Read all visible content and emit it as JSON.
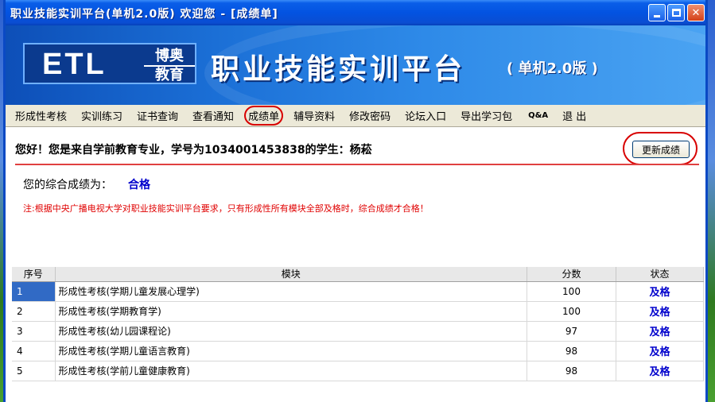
{
  "window": {
    "title": "职业技能实训平台(单机2.0版)  欢迎您 - [成绩单]"
  },
  "banner": {
    "logo_text": "ETL",
    "logo_cn_line1": "博奥",
    "logo_cn_line2": "教育",
    "title": "职业技能实训平台",
    "subtitle": "( 单机2.0版 )"
  },
  "menu": [
    "形成性考核",
    "实训练习",
    "证书查询",
    "查看通知",
    "成绩单",
    "辅导资料",
    "修改密码",
    "论坛入口",
    "导出学习包",
    "Q&A",
    "退 出"
  ],
  "content": {
    "greeting": "您好！您是来自学前教育专业，学号为1034001453838的学生：杨菘",
    "refresh_button": "更新成绩",
    "overall_label": "您的综合成绩为：",
    "overall_value": "合格",
    "note": "注:根据中央广播电视大学对职业技能实训平台要求，只有形成性所有模块全部及格时，综合成绩才合格！"
  },
  "table": {
    "headers": [
      "序号",
      "模块",
      "分数",
      "状态"
    ],
    "rows": [
      {
        "seq": "1",
        "module": "形成性考核(学期儿童发展心理学)",
        "score": "100",
        "status": "及格"
      },
      {
        "seq": "2",
        "module": "形成性考核(学期教育学)",
        "score": "100",
        "status": "及格"
      },
      {
        "seq": "3",
        "module": "形成性考核(幼儿园课程论)",
        "score": "97",
        "status": "及格"
      },
      {
        "seq": "4",
        "module": "形成性考核(学期儿童语言教育)",
        "score": "98",
        "status": "及格"
      },
      {
        "seq": "5",
        "module": "形成性考核(学前儿童健康教育)",
        "score": "98",
        "status": "及格"
      }
    ]
  }
}
